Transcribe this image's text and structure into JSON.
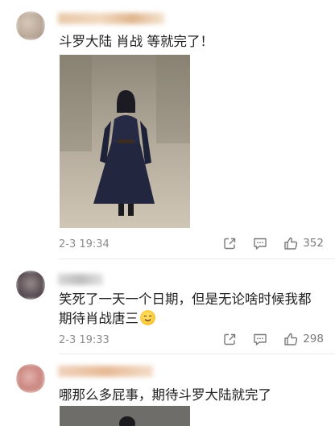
{
  "comments": [
    {
      "text": "斗罗大陆 肖战 等就完了！",
      "time": "2-3 19:34",
      "likes": "352",
      "avatar_color": "#c9b8a9",
      "has_image": true
    },
    {
      "text": "笑死了一天一个日期，但是无论啥时候我都期待肖战唐三",
      "emoji": "smiling-emoji",
      "time": "2-3 19:33",
      "likes": "298",
      "avatar_color": "#6d6266",
      "has_image": false
    },
    {
      "text": "哪那么多屁事，期待斗罗大陆就完了",
      "avatar_color": "#d9a49f",
      "has_image": true
    }
  ],
  "icons": {
    "share": "share-icon",
    "comment": "comment-icon",
    "like": "thumbs-up-icon"
  }
}
